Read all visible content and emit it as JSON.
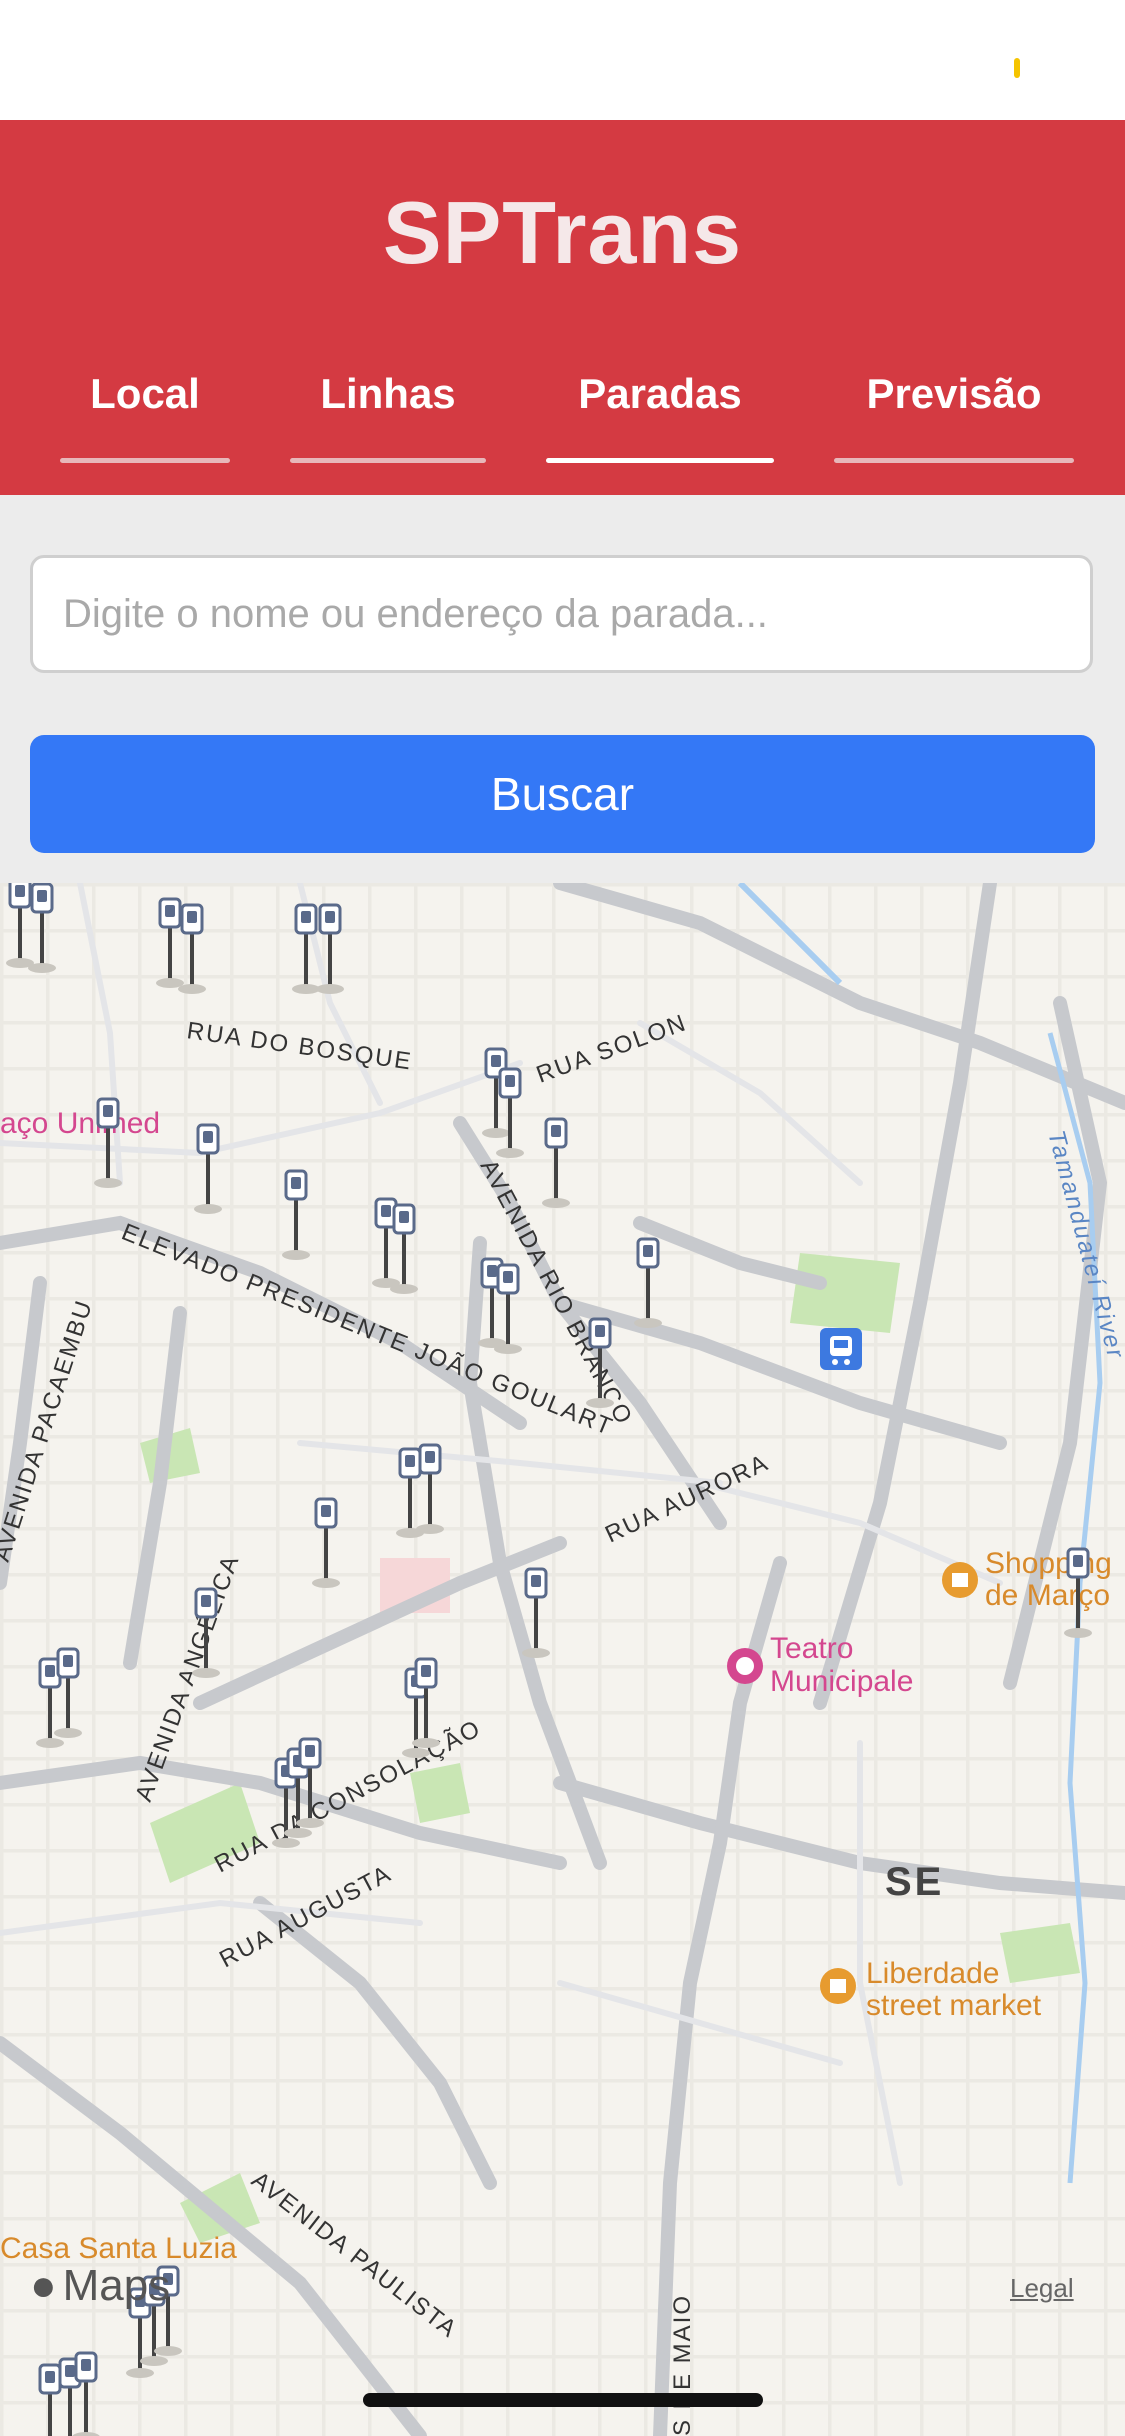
{
  "status_bar": {},
  "header": {
    "title": "SPTrans",
    "tabs": [
      {
        "label": "Local",
        "active": false
      },
      {
        "label": "Linhas",
        "active": false
      },
      {
        "label": "Paradas",
        "active": true
      },
      {
        "label": "Previsão",
        "active": false
      }
    ]
  },
  "search": {
    "placeholder": "Digite o nome ou endereço da parada...",
    "value": "",
    "button_label": "Buscar"
  },
  "map": {
    "street_labels": [
      "RUA DO BOSQUE",
      "RUA SOLON",
      "ELEVADO PRESIDENTE JOÃO GOULART",
      "AVENIDA RIO BRANCO",
      "AVENIDA PACAEMBU",
      "RUA AURORA",
      "AVENIDA ANGÉLICA",
      "RUA DA CONSOLAÇÃO",
      "RUA AUGUSTA",
      "AVENIDA PAULISTA",
      "Tamanduateí River",
      "SE",
      "S DE MAIO"
    ],
    "poi_labels": [
      "aço Unimed",
      "Shopping",
      "de Março",
      "Teatro",
      "Municipale",
      "Liberdade",
      "street market",
      "Casa Santa Luzia"
    ],
    "attribution": "Maps",
    "legal": "Legal"
  },
  "colors": {
    "header": "#d43a42",
    "button": "#3478f6",
    "map_background": "#f5f3ee"
  },
  "icons": [
    "bus-stop-icon",
    "train-station-icon",
    "theater-icon",
    "shopping-icon",
    "apple-logo-icon"
  ]
}
